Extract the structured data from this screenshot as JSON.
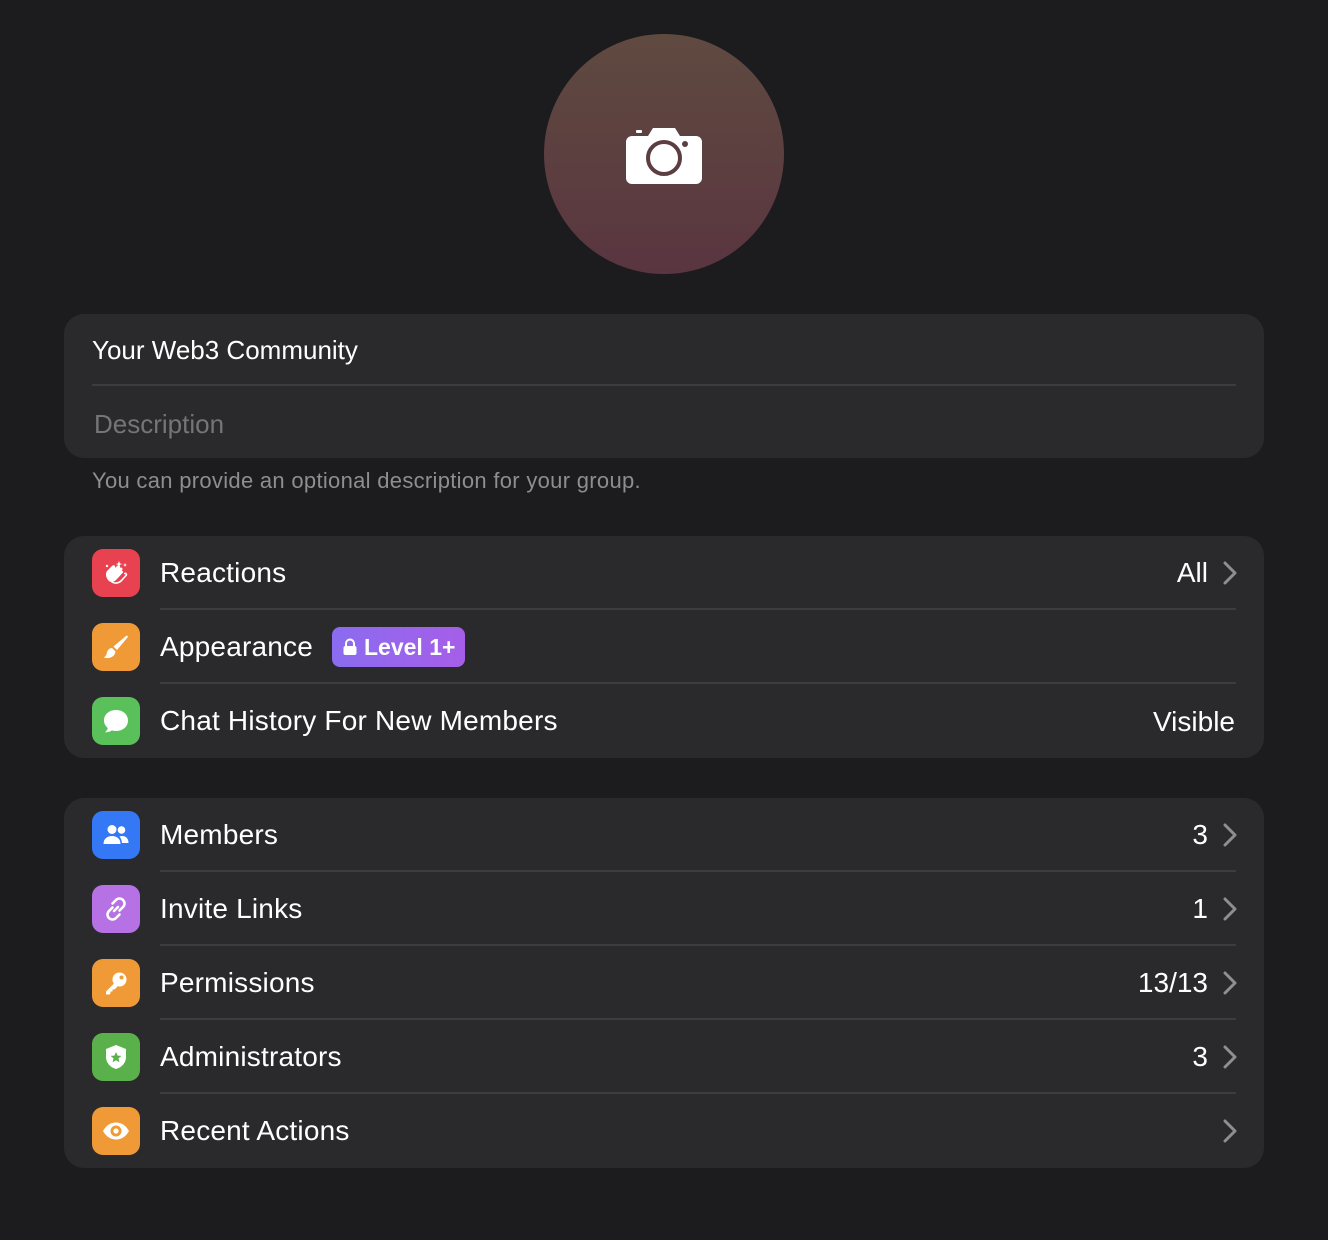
{
  "profile": {
    "avatar_icon": "camera-icon"
  },
  "info": {
    "name_value": "Your Web3 Community",
    "description_placeholder": "Description",
    "helper_text": "You can provide an optional description for your group."
  },
  "settings": {
    "items": [
      {
        "label": "Reactions",
        "value": "All",
        "icon": "clapping-hands-icon",
        "color": "#e8414f",
        "chevron": true
      },
      {
        "label": "Appearance",
        "badge": "Level 1+",
        "icon": "paintbrush-icon",
        "color": "#f09a37",
        "chevron": false
      },
      {
        "label": "Chat History For New Members",
        "value": "Visible",
        "icon": "chat-bubble-icon",
        "color": "#5ac05a",
        "chevron": false
      }
    ]
  },
  "manage": {
    "items": [
      {
        "label": "Members",
        "value": "3",
        "icon": "members-icon",
        "color": "#3478f6"
      },
      {
        "label": "Invite Links",
        "value": "1",
        "icon": "link-icon",
        "color": "#b672e4"
      },
      {
        "label": "Permissions",
        "value": "13/13",
        "icon": "key-icon",
        "color": "#f09a37"
      },
      {
        "label": "Administrators",
        "value": "3",
        "icon": "badge-shield-icon",
        "color": "#5ab04a"
      },
      {
        "label": "Recent Actions",
        "value": "",
        "icon": "eye-icon",
        "color": "#f09a37"
      }
    ]
  },
  "colors": {
    "background": "#1c1c1e",
    "card": "#2a2a2c",
    "divider": "#3d3d40",
    "secondary_text": "#8d8d92",
    "badge_gradient_start": "#8a6cf0",
    "badge_gradient_end": "#a65ee8"
  }
}
